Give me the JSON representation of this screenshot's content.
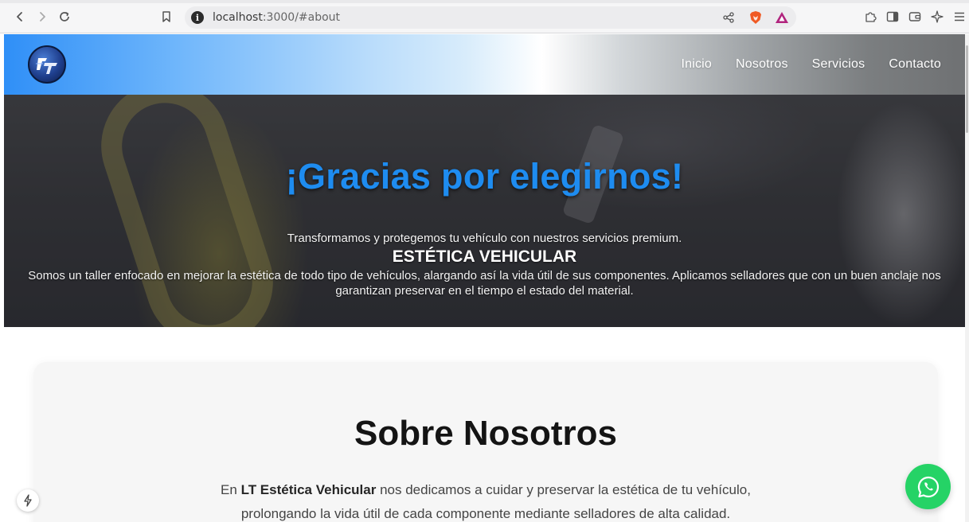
{
  "browser": {
    "url_host": "localhost",
    "url_rest": ":3000/#about",
    "info_symbol": "i"
  },
  "site": {
    "logo_icon": "lt-logo-icon",
    "nav": [
      {
        "label": "Inicio"
      },
      {
        "label": "Nosotros"
      },
      {
        "label": "Servicios"
      },
      {
        "label": "Contacto"
      }
    ]
  },
  "hero": {
    "title": "¡Gracias por elegirnos!",
    "subtitle": "Transformamos y protegemos tu vehículo con nuestros servicios premium.",
    "heading": "ESTÉTICA VEHICULAR",
    "paragraph": "Somos un taller enfocado en mejorar la estética de todo tipo de vehículos, alargando así la vida útil de sus componentes. Aplicamos selladores que con un buen anclaje nos garantizan preservar en el tiempo el estado del material."
  },
  "about": {
    "title": "Sobre Nosotros",
    "text_prefix": "En ",
    "brand": "LT Estética Vehicular",
    "text_suffix": " nos dedicamos a cuidar y preservar la estética de tu vehículo, prolongando la vida útil de cada componente mediante selladores de alta calidad."
  },
  "colors": {
    "accent_blue": "#1e8cf0",
    "whatsapp_green": "#25d366"
  }
}
